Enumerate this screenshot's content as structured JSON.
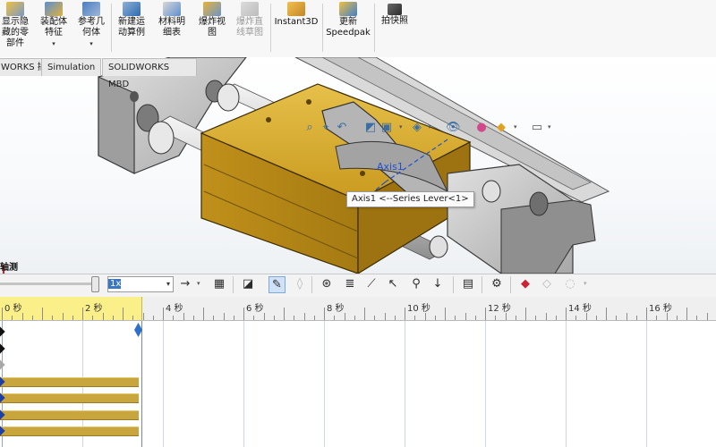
{
  "ribbon": {
    "buttons": [
      {
        "label": "显示隐\n藏的零\n部件",
        "icon": "show-hidden-components-icon",
        "has_dropdown": false,
        "enabled": true
      },
      {
        "label": "装配体\n特征",
        "icon": "assembly-features-icon",
        "has_dropdown": true,
        "enabled": true
      },
      {
        "label": "参考几\n何体",
        "icon": "reference-geometry-icon",
        "has_dropdown": true,
        "enabled": true
      },
      {
        "label": "新建运\n动算例",
        "icon": "new-motion-study-icon",
        "has_dropdown": false,
        "enabled": true
      },
      {
        "label": "材料明\n细表",
        "icon": "bill-of-materials-icon",
        "has_dropdown": false,
        "enabled": true
      },
      {
        "label": "爆炸视\n图",
        "icon": "exploded-view-icon",
        "has_dropdown": false,
        "enabled": true
      },
      {
        "label": "爆炸直\n线草图",
        "icon": "explode-line-sketch-icon",
        "has_dropdown": false,
        "enabled": false
      },
      {
        "label": "Instant3D",
        "icon": "instant3d-icon",
        "has_dropdown": false,
        "enabled": true
      },
      {
        "label": "更新\nSpeedpak",
        "icon": "update-speedpak-icon",
        "has_dropdown": false,
        "enabled": true
      },
      {
        "label": "拍快照",
        "icon": "take-snapshot-icon",
        "has_dropdown": false,
        "enabled": true
      }
    ]
  },
  "tabs": [
    {
      "label": "WORKS 插件"
    },
    {
      "label": "Simulation"
    },
    {
      "label": "SOLIDWORKS MBD"
    }
  ],
  "viewport": {
    "view_toolbar_icons": [
      "zoom-to-fit-icon",
      "zoom-to-area-icon",
      "previous-view-icon",
      "section-view-icon",
      "view-orientation-icon",
      "display-style-icon",
      "hide-show-items-icon",
      "edit-appearance-icon",
      "apply-scene-icon",
      "view-settings-icon"
    ],
    "tooltip": "Axis1 <--Series Lever<1>",
    "axis_label": "Axis1",
    "triad_label": "轴测",
    "colors": {
      "brass": "#c99a1e",
      "steel": "#b9b9b9",
      "axis": "#2451c9"
    }
  },
  "motion": {
    "speed_value": "1x",
    "toolbar_icons": [
      "play-from-start-icon",
      "play-icon",
      "stop-icon",
      "calculate-icon",
      "animation-wizard-icon",
      "autokey-icon",
      "add-update-key-icon",
      "motor-icon",
      "spring-icon",
      "damper-icon",
      "force-icon",
      "contact-icon",
      "gravity-icon",
      "results-plots-icon",
      "motion-study-properties-icon",
      "collapse-icon",
      "material-icon",
      "simulation-setup-icon"
    ],
    "timeline": {
      "ticks": [
        "0 秒",
        "2 秒",
        "4 秒",
        "6 秒",
        "8 秒",
        "10 秒",
        "12 秒",
        "14 秒",
        "16 秒"
      ],
      "time_bar_seconds": 3.5
    },
    "tracks": [
      {
        "key": "black-diamond"
      },
      {
        "key": "black-diamond"
      },
      {
        "key": "gray-diamond"
      },
      {
        "key": "blue-diamond",
        "bar": true
      },
      {
        "key": "blue-diamond",
        "bar": true
      },
      {
        "key": "blue-diamond",
        "bar": true
      },
      {
        "key": "blue-diamond",
        "bar": true
      }
    ]
  }
}
